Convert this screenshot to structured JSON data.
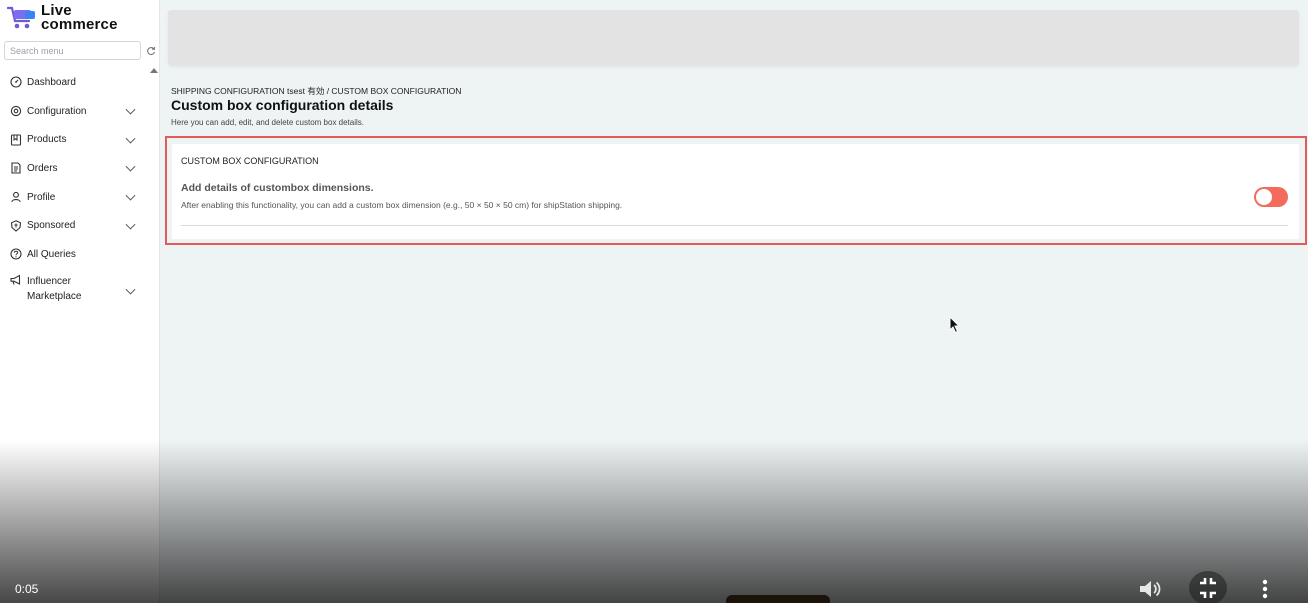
{
  "brand": {
    "line1": "Live",
    "line2": "commerce"
  },
  "search": {
    "placeholder": "Search menu"
  },
  "nav": {
    "items": [
      {
        "label": "Dashboard",
        "icon": "dashboard-icon",
        "expandable": false
      },
      {
        "label": "Configuration",
        "icon": "gear-icon",
        "expandable": true
      },
      {
        "label": "Products",
        "icon": "bookmark-icon",
        "expandable": true
      },
      {
        "label": "Orders",
        "icon": "document-icon",
        "expandable": true
      },
      {
        "label": "Profile",
        "icon": "user-icon",
        "expandable": true
      },
      {
        "label": "Sponsored",
        "icon": "badge-icon",
        "expandable": true
      },
      {
        "label": "All Queries",
        "icon": "question-icon",
        "expandable": false
      },
      {
        "label": "Influencer Marketplace",
        "icon": "megaphone-icon",
        "expandable": true
      }
    ]
  },
  "page": {
    "breadcrumb": "SHIPPING CONFIGURATION tsest 有効 / CUSTOM BOX CONFIGURATION",
    "title": "Custom box configuration details",
    "description": "Here you can add, edit, and delete custom box details."
  },
  "card": {
    "heading": "CUSTOM BOX CONFIGURATION",
    "subheading": "Add details of custombox dimensions.",
    "description": "After enabling this functionality, you can add a custom box dimension (e.g., 50 × 50 × 50 cm) for shipStation shipping.",
    "toggle_on": false
  },
  "video": {
    "time": "0:05"
  },
  "colors": {
    "accent": "#f36b5a",
    "highlight": "#e4595a",
    "sidebar_bg": "#ffffff",
    "main_bg": "#eef3f4"
  }
}
